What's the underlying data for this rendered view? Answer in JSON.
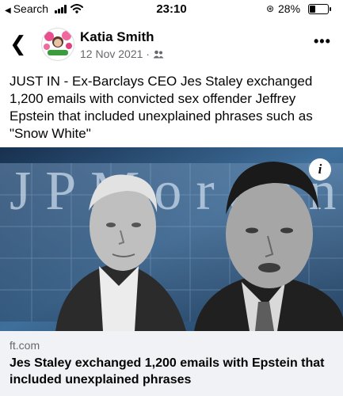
{
  "status_bar": {
    "back_label": "Search",
    "time": "23:10",
    "battery_percent": "28%",
    "battery_level": 0.28
  },
  "post_header": {
    "author": "Katia Smith",
    "date": "12 Nov 2021",
    "separator": "·",
    "audience_icon": "friends-icon"
  },
  "post": {
    "text": "JUST IN - Ex-Barclays CEO Jes Staley exchanged 1,200 emails with convicted sex offender Jeffrey Epstein that included unexplained phrases such as \"Snow White\""
  },
  "link_preview": {
    "image_logo_text": "JPMorgan",
    "info_label": "i",
    "domain": "ft.com",
    "title": "Jes Staley exchanged 1,200 emails with Epstein that included unexplained phrases"
  }
}
